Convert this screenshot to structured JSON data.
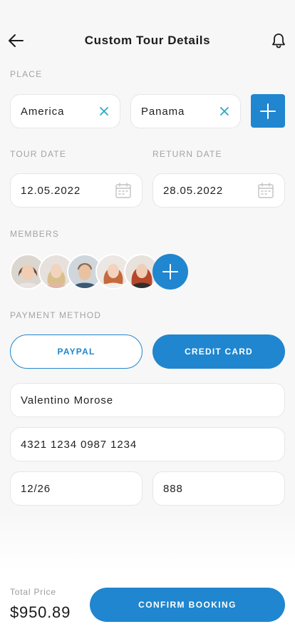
{
  "header": {
    "title": "Custom Tour Details",
    "back_icon": "arrow-left-icon",
    "notification_icon": "bell-icon"
  },
  "place": {
    "label": "PLACE",
    "origin": "America",
    "destination": "Panama",
    "clear_icon": "close-icon",
    "add_icon": "plus-icon"
  },
  "dates": {
    "tour_label": "TOUR DATE",
    "tour_value": "12.05.2022",
    "return_label": "RETURN DATE",
    "return_value": "28.05.2022",
    "calendar_icon": "calendar-icon"
  },
  "members": {
    "label": "MEMBERS",
    "avatars": [
      "avatar-1",
      "avatar-2",
      "avatar-3",
      "avatar-4",
      "avatar-5"
    ],
    "add_icon": "plus-icon"
  },
  "payment": {
    "label": "PAYMENT METHOD",
    "paypal": "PAYPAL",
    "credit_card": "CREDIT CARD",
    "selected": "CREDIT CARD",
    "card_holder": "Valentino Morose",
    "card_number": "4321 1234 0987 1234",
    "expiry": "12/26",
    "cvv": "888"
  },
  "footer": {
    "total_label": "Total Price",
    "total_value": "$950.89",
    "confirm": "CONFIRM BOOKING"
  },
  "colors": {
    "accent": "#1f86cf",
    "clear_icon": "#2aa9c7",
    "background": "#f7f7f7"
  }
}
